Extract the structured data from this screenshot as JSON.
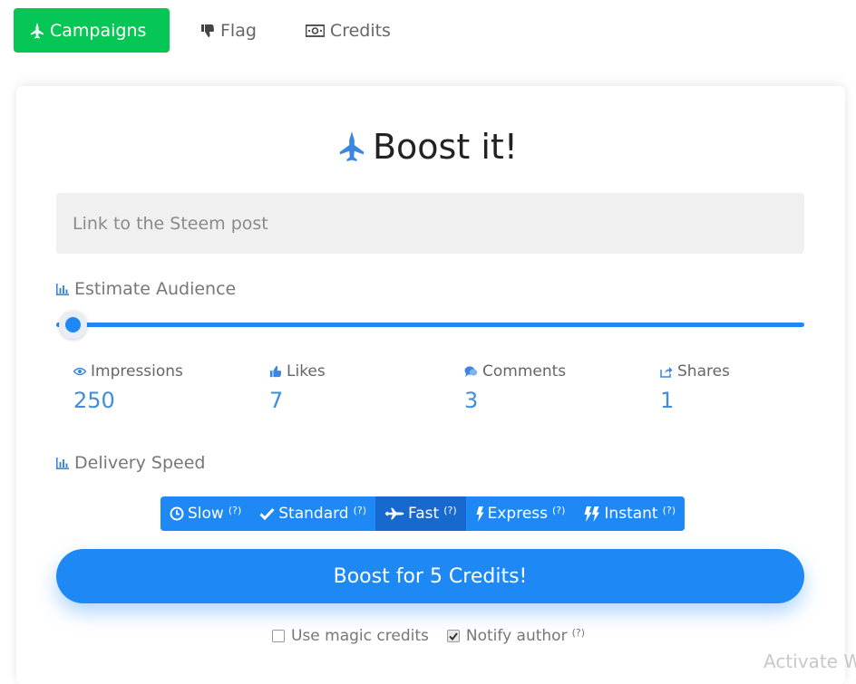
{
  "nav": {
    "tabs": [
      {
        "label": "Campaigns",
        "icon": "plane-icon",
        "active": true
      },
      {
        "label": "Flag",
        "icon": "thumbs-down-icon",
        "active": false
      },
      {
        "label": "Credits",
        "icon": "money-icon",
        "active": false
      }
    ]
  },
  "title": "Boost it!",
  "link_input": {
    "placeholder": "Link to the Steem post",
    "value": ""
  },
  "audience": {
    "label": "Estimate Audience",
    "slider_level": 0,
    "stats": [
      {
        "label": "Impressions",
        "value": "250",
        "icon": "eye-icon"
      },
      {
        "label": "Likes",
        "value": "7",
        "icon": "thumbs-up-icon"
      },
      {
        "label": "Comments",
        "value": "3",
        "icon": "comments-icon"
      },
      {
        "label": "Shares",
        "value": "1",
        "icon": "share-icon"
      }
    ]
  },
  "delivery": {
    "label": "Delivery Speed",
    "options": [
      {
        "label": "Slow",
        "hint": "(?)",
        "icon": "clock-icon"
      },
      {
        "label": "Standard",
        "hint": "(?)",
        "icon": "check-icon"
      },
      {
        "label": "Fast",
        "hint": "(?)",
        "icon": "plane-icon",
        "active": true
      },
      {
        "label": "Express",
        "hint": "(?)",
        "icon": "bolt-icon"
      },
      {
        "label": "Instant",
        "hint": "(?)",
        "icon": "double-bolt-icon"
      }
    ]
  },
  "boost_button": "Boost for 5 Credits!",
  "options": {
    "magic_credits": {
      "label": "Use magic credits",
      "checked": false
    },
    "notify_author": {
      "label": "Notify author",
      "hint": "(?)",
      "checked": true
    }
  },
  "watermark": "Activate W",
  "colors": {
    "accent": "#1e88f5",
    "green": "#06c755"
  }
}
